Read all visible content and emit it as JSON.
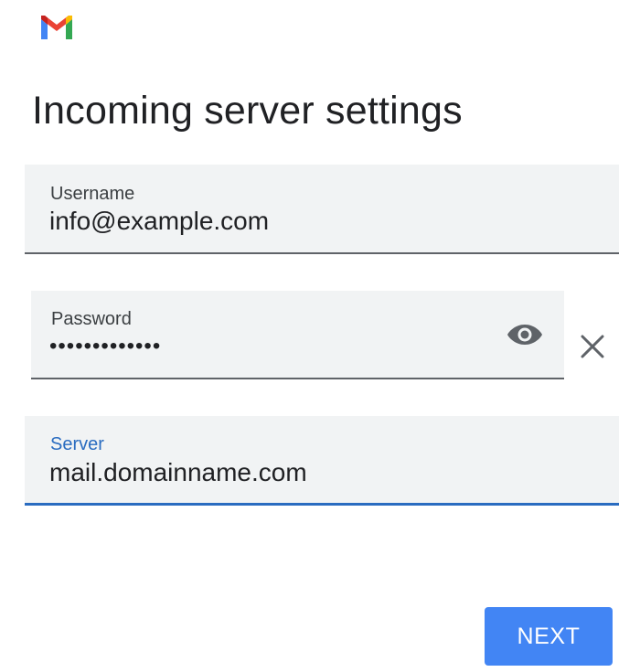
{
  "app": {
    "logo_icon": "gmail-logo",
    "brand_colors": {
      "blue": "#4285f4",
      "red": "#ea4335",
      "yellow": "#fbbc04",
      "green": "#34a853"
    }
  },
  "page": {
    "title": "Incoming server settings"
  },
  "form": {
    "username": {
      "label": "Username",
      "value": "info@example.com"
    },
    "password": {
      "label": "Password",
      "value": "•••••••••••••",
      "toggle_icon": "eye-icon",
      "clear_icon": "close-icon"
    },
    "server": {
      "label": "Server",
      "value": "mail.domainname.com",
      "focused": true,
      "accent_color": "#2a6cc0"
    }
  },
  "actions": {
    "next_label": "NEXT",
    "next_color": "#4285f4"
  }
}
